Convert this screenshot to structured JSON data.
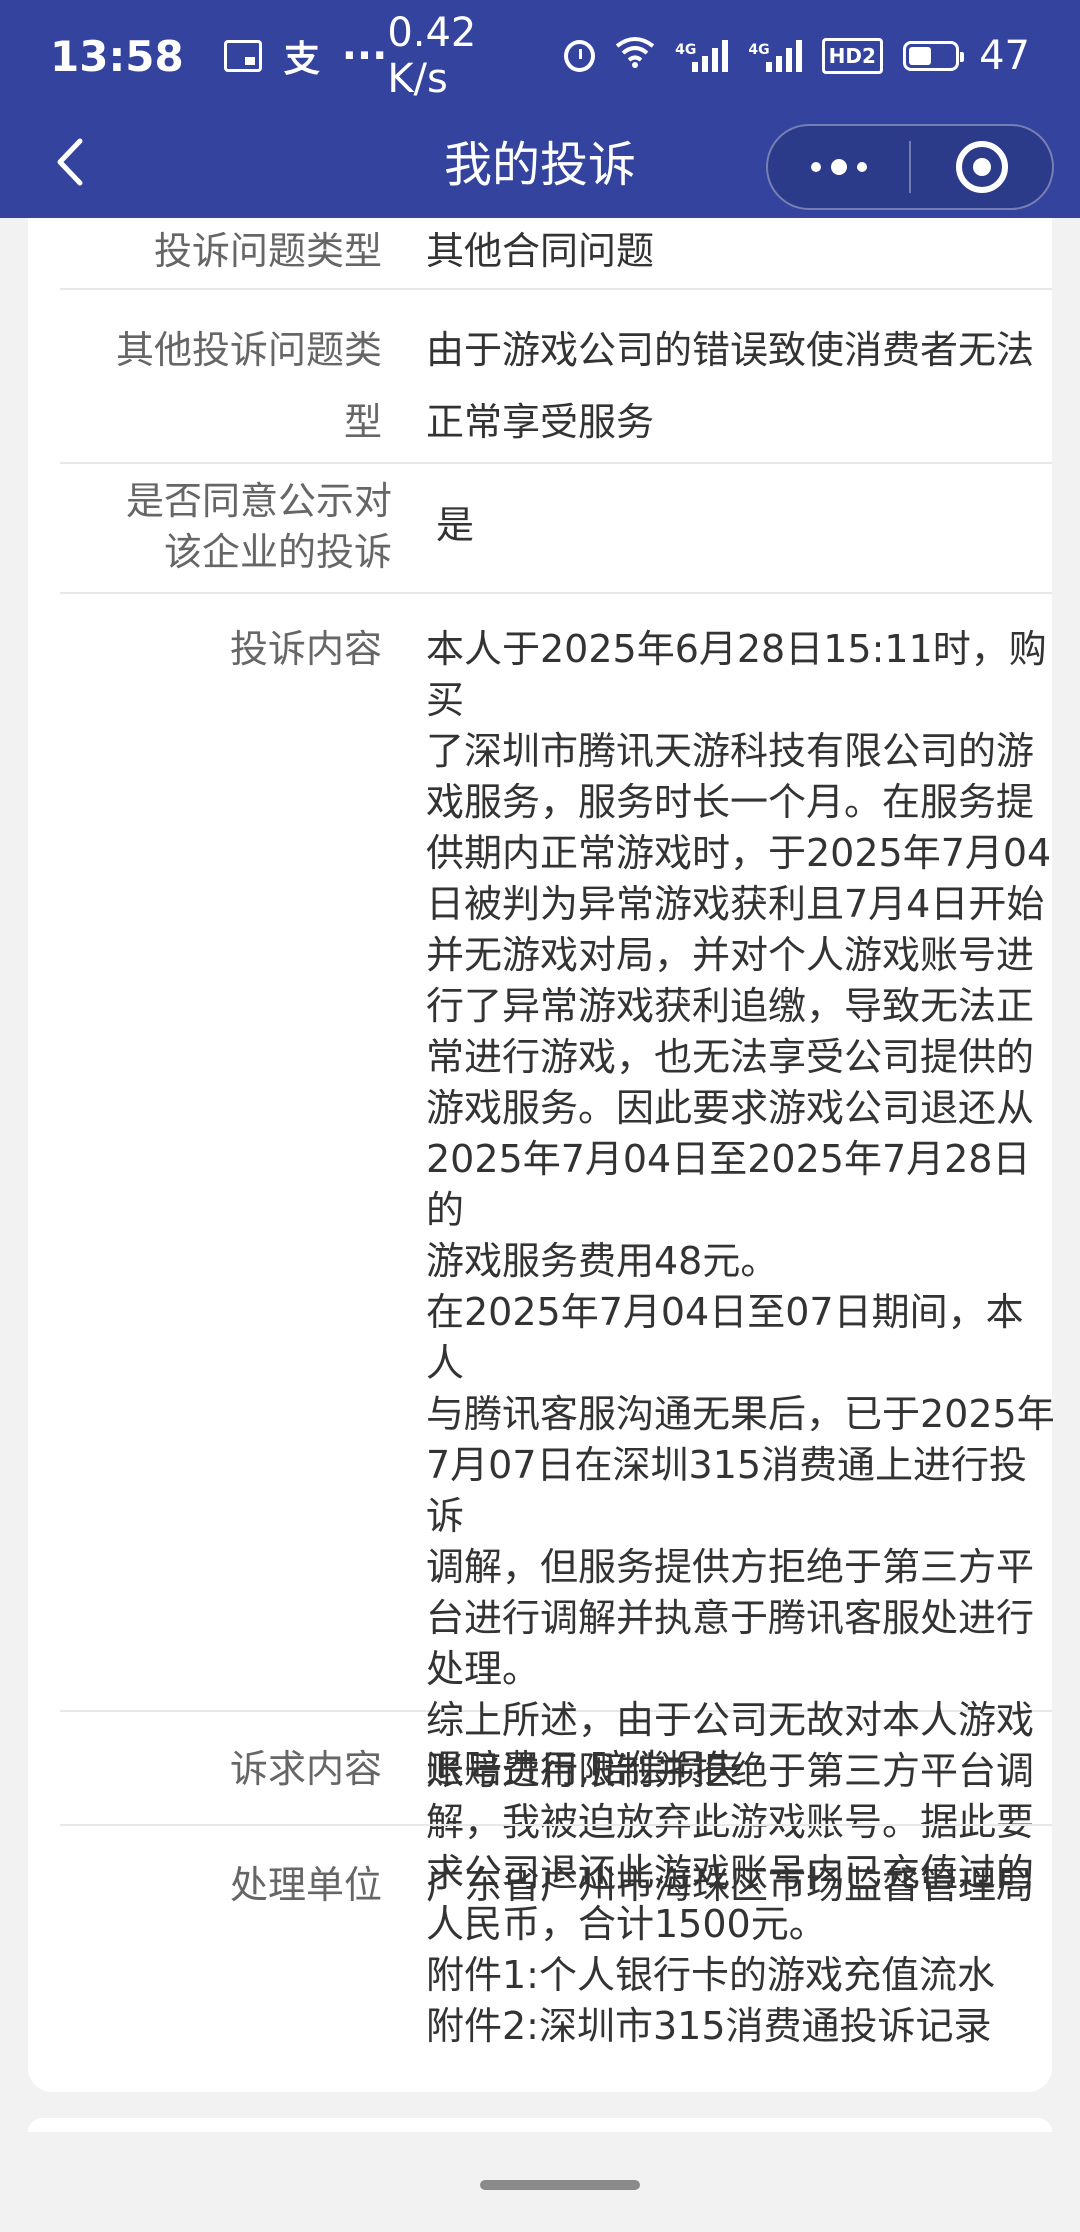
{
  "status_bar": {
    "time": "13:58",
    "more": "···",
    "speed": "0.42 K/s",
    "net1": "4G",
    "net2": "4G",
    "hd": "HD2",
    "battery": "47"
  },
  "nav": {
    "title": "我的投诉"
  },
  "details": [
    {
      "label": "投诉问题类型",
      "value": "其他合同问题"
    },
    {
      "label": "其他投诉问题类\n型",
      "value": "由于游戏公司的错误致使消费者无法\n正常享受服务"
    },
    {
      "label": "是否同意公示对\n该企业的投诉",
      "value": "是"
    },
    {
      "label": "投诉内容",
      "value": "本人于2025年6月28日15:11时，购买\n了深圳市腾讯天游科技有限公司的游\n戏服务，服务时长一个月。在服务提\n供期内正常游戏时，于2025年7月04\n日被判为异常游戏获利且7月4日开始\n并无游戏对局，并对个人游戏账号进\n行了异常游戏获利追缴，导致无法正\n常进行游戏，也无法享受公司提供的\n游戏服务。因此要求游戏公司退还从\n2025年7月04日至2025年7月28日的\n游戏服务费用48元。\n在2025年7月04日至07日期间，本人\n与腾讯客服沟通无果后，已于2025年\n7月07日在深圳315消费通上进行投诉\n调解，但服务提供方拒绝于第三方平\n台进行调解并执意于腾讯客服处进行\n处理。\n综上所述，由于公司无故对本人游戏\n账号进行限制并拒绝于第三方平台调\n解，我被迫放弃此游戏账号。据此要\n求公司退还此游戏账号内已充值过的\n人民币，合计1500元。\n附件1:个人银行卡的游戏充值流水\n附件2:深圳市315消费通投诉记录"
    },
    {
      "label": "诉求内容",
      "value": "退赔费用,赔偿损失"
    },
    {
      "label": "处理单位",
      "value": "广东省广州市海珠区市场监督管理局"
    }
  ]
}
